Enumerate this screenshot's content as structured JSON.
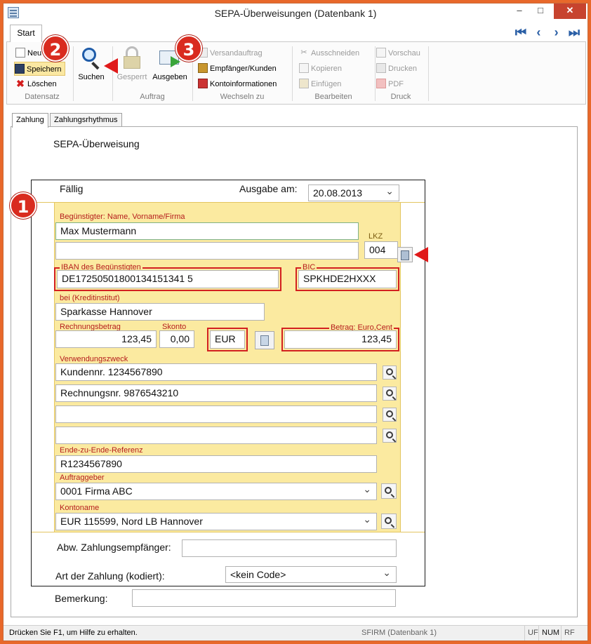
{
  "window": {
    "title": "SEPA-Überweisungen (Datenbank 1)"
  },
  "ribbon": {
    "tab": "Start",
    "groups": {
      "datensatz": {
        "label": "Datensatz",
        "neu": "Neu",
        "speichern": "Speichern",
        "loeschen": "Löschen"
      },
      "suchen": {
        "label": "Suchen"
      },
      "auftrag": {
        "label": "Auftrag",
        "gesperrt": "Gesperrt",
        "ausgeben": "Ausgeben"
      },
      "wechseln": {
        "label": "Wechseln zu",
        "versandauftrag": "Versandauftrag",
        "empfaenger": "Empfänger/Kunden",
        "kontoinfo": "Kontoinformationen"
      },
      "bearbeiten": {
        "label": "Bearbeiten",
        "ausschneiden": "Ausschneiden",
        "kopieren": "Kopieren",
        "einfuegen": "Einfügen"
      },
      "druck": {
        "label": "Druck",
        "vorschau": "Vorschau",
        "drucken": "Drucken",
        "pdf": "PDF"
      }
    }
  },
  "badges": {
    "one": "1",
    "two": "2",
    "three": "3"
  },
  "page_tabs": {
    "zahlung": "Zahlung",
    "rhythmus": "Zahlungsrhythmus"
  },
  "form": {
    "heading": "SEPA-Überweisung",
    "faellig": "Fällig",
    "ausgabe_label": "Ausgabe am:",
    "ausgabe_value": "20.08.2013",
    "beguenstigter_label": "Begünstigter: Name, Vorname/Firma",
    "beguenstigter_value": "Max Mustermann",
    "lkz_label": "LKZ",
    "lkz_value": "004",
    "iban_label": "IBAN des Begünstigten",
    "iban_value": "DE17250501800134151341 5",
    "bic_label": "BIC",
    "bic_value": "SPKHDE2HXXX",
    "bank_label": "bei (Kreditinstitut)",
    "bank_value": "Sparkasse Hannover",
    "rechnungsbetrag_label": "Rechnungsbetrag",
    "rechnungsbetrag_value": "123,45",
    "skonto_label": "Skonto",
    "skonto_value": "0,00",
    "waehrung_value": "EUR",
    "betrag_label": "Betrag: Euro,Cent",
    "betrag_value": "123,45",
    "verwendungszweck_label": "Verwendungszweck",
    "verwendungszweck": [
      "Kundennr. 1234567890",
      "Rechnungsnr. 9876543210",
      "",
      ""
    ],
    "e2e_label": "Ende-zu-Ende-Referenz",
    "e2e_value": "R1234567890",
    "auftraggeber_label": "Auftraggeber",
    "auftraggeber_value": "0001 Firma ABC",
    "kontoname_label": "Kontoname",
    "kontoname_value": "EUR 115599, Nord LB Hannover",
    "abw_label": "Abw. Zahlungsempfänger:",
    "abw_value": "",
    "art_label": "Art der Zahlung (kodiert):",
    "art_value": "<kein Code>",
    "bemerkung_label": "Bemerkung:",
    "bemerkung_value": ""
  },
  "status": {
    "help": "Drücken Sie F1, um Hilfe zu erhalten.",
    "db": "SFIRM (Datenbank 1)",
    "uf": "UF",
    "num": "NUM",
    "rf": "RF"
  }
}
